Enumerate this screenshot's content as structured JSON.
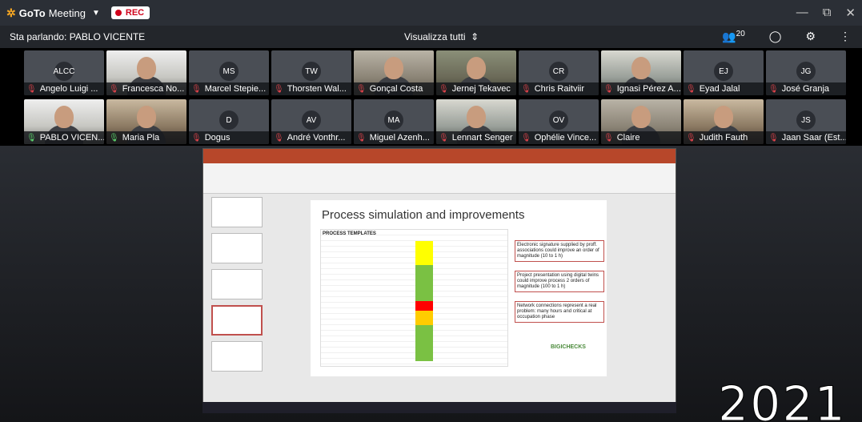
{
  "app": {
    "brand_bold": "GoTo",
    "brand_light": "Meeting",
    "rec_label": "REC",
    "window_controls": [
      "—",
      "⧉",
      "✕"
    ]
  },
  "speaker_bar": {
    "speaking": "Sta parlando: PABLO VICENTE",
    "view_all": "Visualizza tutti",
    "participants_count": "20"
  },
  "participants": [
    {
      "name": "Angelo Luigi ...",
      "initials": "ALCC",
      "video": false,
      "mic_on": false
    },
    {
      "name": "Francesca No...",
      "initials": "",
      "video": true,
      "cam": "c4",
      "mic_on": false
    },
    {
      "name": "Marcel Stepie...",
      "initials": "MS",
      "video": false,
      "mic_on": false
    },
    {
      "name": "Thorsten Wal...",
      "initials": "TW",
      "video": false,
      "mic_on": false
    },
    {
      "name": "Gonçal Costa",
      "initials": "",
      "video": true,
      "cam": "c1",
      "mic_on": false
    },
    {
      "name": "Jernej Tekavec",
      "initials": "",
      "video": true,
      "cam": "c3",
      "mic_on": false
    },
    {
      "name": "Chris Raitviir",
      "initials": "CR",
      "video": false,
      "mic_on": false
    },
    {
      "name": "Ignasi Pérez A...",
      "initials": "",
      "video": true,
      "cam": "c2",
      "mic_on": false
    },
    {
      "name": "Eyad Jalal",
      "initials": "EJ",
      "video": false,
      "mic_on": false
    },
    {
      "name": "José Granja",
      "initials": "JG",
      "video": false,
      "mic_on": false
    },
    {
      "name": "PABLO VICEN...",
      "initials": "",
      "video": true,
      "cam": "c4",
      "mic_on": true
    },
    {
      "name": "Maria Pla",
      "initials": "",
      "video": true,
      "cam": "c5",
      "mic_on": true
    },
    {
      "name": "Dogus",
      "initials": "D",
      "video": false,
      "mic_on": false
    },
    {
      "name": "André Vonthr...",
      "initials": "AV",
      "video": false,
      "mic_on": false
    },
    {
      "name": "Miguel Azenh...",
      "initials": "MA",
      "video": false,
      "mic_on": false
    },
    {
      "name": "Lennart Senger",
      "initials": "",
      "video": true,
      "cam": "c2",
      "mic_on": false
    },
    {
      "name": "Ophélie Vince...",
      "initials": "OV",
      "video": false,
      "mic_on": false
    },
    {
      "name": "Claire",
      "initials": "",
      "video": true,
      "cam": "c1",
      "mic_on": false
    },
    {
      "name": "Judith Fauth",
      "initials": "",
      "video": true,
      "cam": "c5",
      "mic_on": false
    },
    {
      "name": "Jaan Saar (Est...",
      "initials": "JS",
      "video": false,
      "mic_on": false
    }
  ],
  "shared_screen": {
    "slide_title": "Process simulation and improvements",
    "table_title": "PROCESS TEMPLATES",
    "notes": [
      "Electronic signature supplied by proff. associations could improve an order of magnitude (10 to 1 h)",
      "Project presentation using digital twins could improve process 2 orders of magnitude (100 to 1 h)",
      "Network connections represent a real problem: many hours and critical at occupation phase"
    ],
    "logo": "BIGICHECKS"
  },
  "overlay": {
    "year": "2021"
  }
}
